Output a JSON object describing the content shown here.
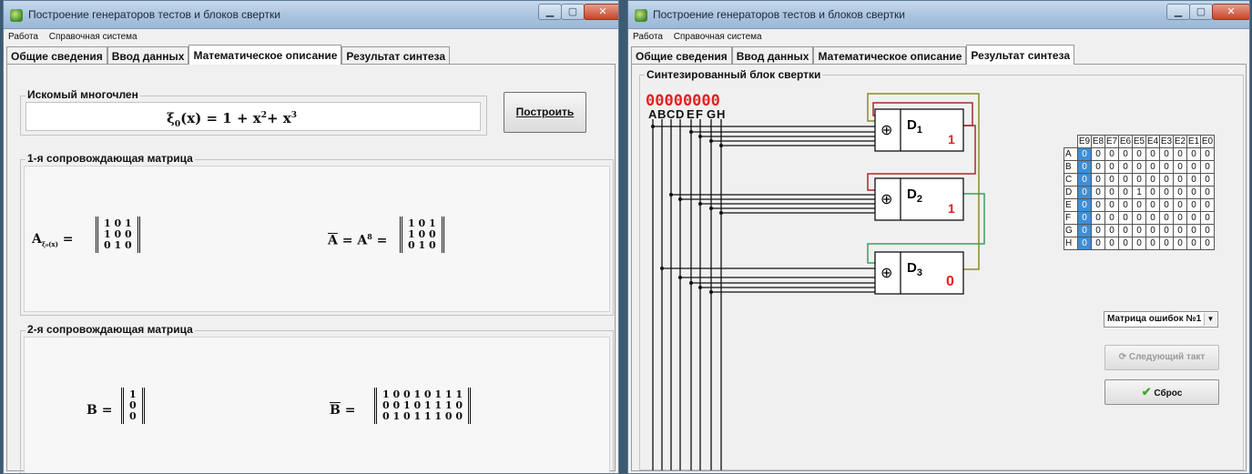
{
  "left_window": {
    "title": "Построение генераторов тестов и блоков свертки",
    "menu": [
      "Работа",
      "Справочная система"
    ],
    "tabs": [
      "Общие сведения",
      "Ввод данных",
      "Математическое описание",
      "Результат синтеза"
    ],
    "active_tab": 2,
    "poly_group": "Искомый многочлен",
    "poly_lhs": "ξ",
    "poly_sub": "0",
    "poly_rest": "(x) = 1 + x",
    "poly_exp1": "2",
    "poly_plus": "+ x",
    "poly_exp2": "3",
    "build_button": "Построить",
    "group1": "1-я сопровождающая матрица",
    "matA_label": "A",
    "matA_sub": "ξ₀(x)",
    "matA_eq": "=",
    "matA_rows": [
      "1 0 1",
      "1 0 0",
      "0 1 0"
    ],
    "matAbar_label": "A",
    "matAbar_eq1": "= A",
    "matAbar_exp": "8",
    "matAbar_eq2": "=",
    "matAbar_rows": [
      "1 0 1",
      "1 0 0",
      "0 1 0"
    ],
    "group2": "2-я сопровождающая матрица",
    "matB_label": "B",
    "matB_eq": "=",
    "matB_rows": [
      "1",
      "0",
      "0"
    ],
    "matBbar_label": "B",
    "matBbar_eq": "=",
    "matBbar_rows": [
      "1 0 0 1 0 1 1 1",
      "0 0 1 0 1 1 1 0",
      "0 1 0 1 1 1 0 0"
    ]
  },
  "right_window": {
    "title": "Построение генераторов тестов и блоков свертки",
    "menu": [
      "Работа",
      "Справочная система"
    ],
    "tabs": [
      "Общие сведения",
      "Ввод данных",
      "Математическое описание",
      "Результат синтеза"
    ],
    "active_tab": 3,
    "group": "Синтезированный блок свертки",
    "digits": "00000000",
    "letters": [
      "A",
      "B",
      "C",
      "D",
      "E",
      "F",
      "G",
      "H"
    ],
    "blocks": [
      {
        "name": "D",
        "sub": "1",
        "out": "1",
        "symbol": "⊕"
      },
      {
        "name": "D",
        "sub": "2",
        "out": "1",
        "symbol": "⊕"
      },
      {
        "name": "D",
        "sub": "3",
        "out": "0",
        "symbol": "⊕"
      }
    ],
    "table_headers": [
      "E9",
      "E8",
      "E7",
      "E6",
      "E5",
      "E4",
      "E3",
      "E2",
      "E1",
      "E0"
    ],
    "table_rows": [
      {
        "label": "A",
        "values": [
          "0",
          "0",
          "0",
          "0",
          "0",
          "0",
          "0",
          "0",
          "0",
          "0"
        ]
      },
      {
        "label": "B",
        "values": [
          "0",
          "0",
          "0",
          "0",
          "0",
          "0",
          "0",
          "0",
          "0",
          "0"
        ]
      },
      {
        "label": "C",
        "values": [
          "0",
          "0",
          "0",
          "0",
          "0",
          "0",
          "0",
          "0",
          "0",
          "0"
        ]
      },
      {
        "label": "D",
        "values": [
          "0",
          "0",
          "0",
          "0",
          "1",
          "0",
          "0",
          "0",
          "0",
          "0"
        ]
      },
      {
        "label": "E",
        "values": [
          "0",
          "0",
          "0",
          "0",
          "0",
          "0",
          "0",
          "0",
          "0",
          "0"
        ]
      },
      {
        "label": "F",
        "values": [
          "0",
          "0",
          "0",
          "0",
          "0",
          "0",
          "0",
          "0",
          "0",
          "0"
        ]
      },
      {
        "label": "G",
        "values": [
          "0",
          "0",
          "0",
          "0",
          "0",
          "0",
          "0",
          "0",
          "0",
          "0"
        ]
      },
      {
        "label": "H",
        "values": [
          "0",
          "0",
          "0",
          "0",
          "0",
          "0",
          "0",
          "0",
          "0",
          "0"
        ]
      }
    ],
    "select_value": "Матрица ошибок №1",
    "next_button": "Следующий такт",
    "reset_button": "Сброс"
  }
}
